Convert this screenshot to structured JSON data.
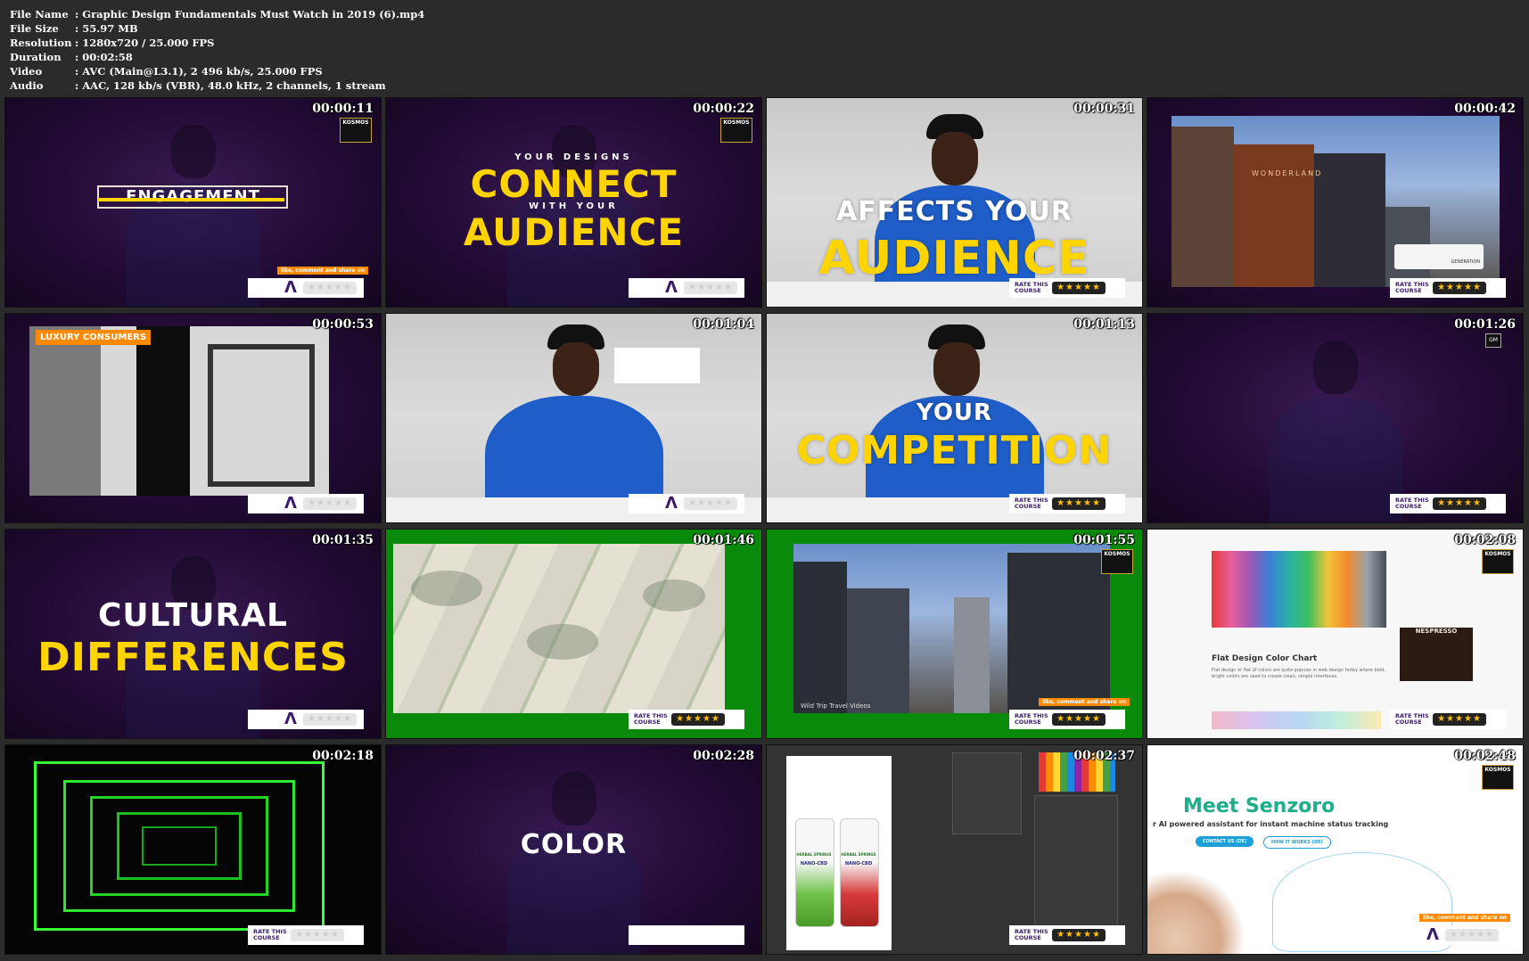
{
  "meta": [
    {
      "label": "File Name",
      "value": ":  Graphic Design Fundamentals  Must Watch in 2019 (6).mp4"
    },
    {
      "label": "File Size",
      "value": ":  55.97 MB"
    },
    {
      "label": "Resolution",
      "value": ":  1280x720 / 25.000 FPS"
    },
    {
      "label": "Duration",
      "value": ":  00:02:58"
    },
    {
      "label": "Video",
      "value": ":  AVC (Main@L3.1), 2 496 kb/s, 25.000 FPS"
    },
    {
      "label": "Audio",
      "value": ":  AAC, 128 kb/s (VBR), 48.0 kHz, 2 channels, 1 stream"
    }
  ],
  "thumbs": [
    {
      "time": "00:00:11",
      "text1": "ENGAGEMENT",
      "share": "like, comment and share on",
      "logo": "KOSMOS"
    },
    {
      "time": "00:00:22",
      "small1": "YOUR DESIGNS",
      "text1": "CONNECT",
      "small2": "WITH YOUR",
      "text2": "AUDIENCE",
      "logo": "KOSMOS"
    },
    {
      "time": "00:00:31",
      "text1": "AFFECTS YOUR",
      "text2": "AUDIENCE",
      "rate": "RATE THIS COURSE",
      "stars": "★★★★★"
    },
    {
      "time": "00:00:42",
      "rate": "RATE THIS COURSE",
      "stars": "★★★★★",
      "caption": "WONDERLAND",
      "truck": "GENERATION"
    },
    {
      "time": "00:00:53",
      "tag": "LUXURY CONSUMERS"
    },
    {
      "time": "00:01:04"
    },
    {
      "time": "00:01:13",
      "text1": "YOUR",
      "text2": "COMPETITION",
      "rate": "RATE THIS COURSE",
      "stars": "★★★★★"
    },
    {
      "time": "00:01:26",
      "logo": "GM"
    },
    {
      "time": "00:01:35",
      "text1": "CULTURAL",
      "text2": "DIFFERENCES"
    },
    {
      "time": "00:01:46",
      "rate": "RATE THIS COURSE",
      "stars": "★★★★★"
    },
    {
      "time": "00:01:55",
      "rate": "RATE THIS COURSE",
      "stars": "★★★★★",
      "share": "like, comment and share on",
      "logo": "KOSMOS",
      "watermark": "Wild Trip Travel Videos"
    },
    {
      "time": "00:02:08",
      "heading": "Flat Design Color Chart",
      "body": "Flat design or flat UI colors are quite popular in web design today where bold, bright colors are used to create clean, simple interfaces.",
      "brand": "NESPRESSO",
      "rate": "RATE THIS COURSE",
      "stars": "★★★★★",
      "logo": "KOSMOS"
    },
    {
      "time": "00:02:18",
      "rate": "RATE THIS COURSE"
    },
    {
      "time": "00:02:28",
      "text1": "COLOR"
    },
    {
      "time": "00:02:37",
      "rate": "RATE THIS COURSE",
      "stars": "★★★★★",
      "can1": "HERBAL SPRINGS",
      "can1b": "NANO-CBD",
      "can2": "HERBAL SPRINGS",
      "can2b": "NANO-CBD"
    },
    {
      "time": "00:02:48",
      "title": "Meet Senzoro",
      "sub": "r AI powered assistant for instant machine status tracking",
      "btn1": "CONTACT US (DE)",
      "btn2": "HOW IT WORKS (DE)",
      "share": "like, comment and share on",
      "logo": "KOSMOS"
    }
  ],
  "colors": {
    "accent_yellow": "#ffd400",
    "purple": "#220b36",
    "shirt_blue": "#1f5ec9",
    "green_screen": "#0a8a0a",
    "star": "#ffbf00"
  }
}
